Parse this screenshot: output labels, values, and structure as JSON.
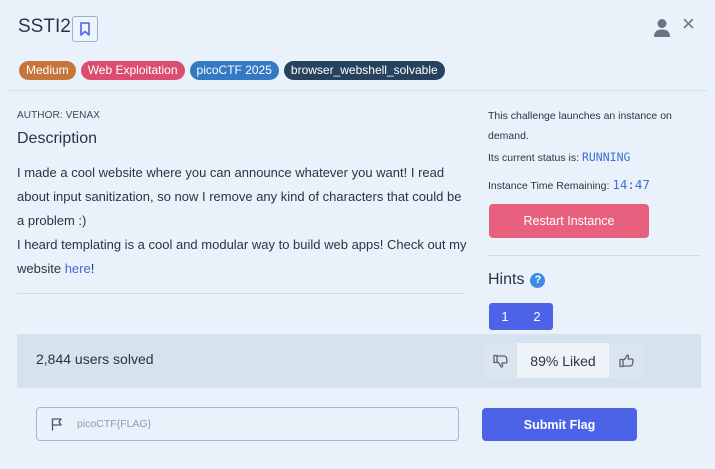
{
  "header": {
    "title": "SSTI2",
    "bookmark_icon": "bookmark-icon",
    "user_icon": "user-icon",
    "close_icon": "close-icon",
    "close_glyph": "×"
  },
  "tags": [
    {
      "label": "Medium",
      "color": "#c7763b"
    },
    {
      "label": "Web Exploitation",
      "color": "#dc4d6f"
    },
    {
      "label": "picoCTF 2025",
      "color": "#3479c4"
    },
    {
      "label": "browser_webshell_solvable",
      "color": "#27425e"
    }
  ],
  "challenge": {
    "author": "AUTHOR: VENAX",
    "description_heading": "Description",
    "description_p1": "I made a cool website where you can announce whatever you want! I read about input sanitization, so now I remove any kind of characters that could be a problem :)",
    "description_p2_prefix": "I heard templating is a cool and modular way to build web apps! Check out my website ",
    "description_link": "here",
    "description_p2_suffix": "!"
  },
  "instance": {
    "launch_text": "This challenge launches an instance on demand.",
    "status_label": "Its current status is: ",
    "status_value": "RUNNING",
    "time_label": "Instance Time Remaining: ",
    "time_value": "14:47",
    "restart_label": "Restart Instance"
  },
  "hints": {
    "heading": "Hints",
    "help_glyph": "?",
    "tabs": [
      "1",
      "2"
    ]
  },
  "stats": {
    "solved": "2,844 users solved",
    "liked": "89% Liked"
  },
  "flag": {
    "placeholder": "picoCTF{FLAG}",
    "submit_label": "Submit Flag"
  },
  "colors": {
    "accent": "#4c63e8",
    "restart": "#e7617f",
    "background": "#e9f1fb"
  }
}
